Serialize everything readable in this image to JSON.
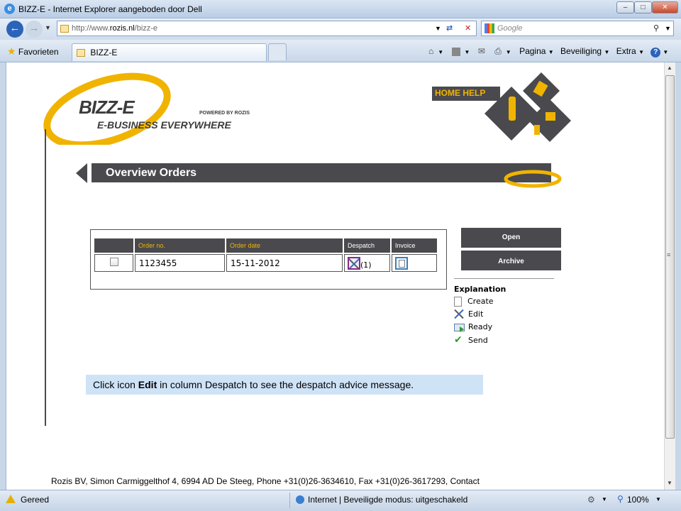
{
  "window": {
    "title": "BIZZ-E - Internet Explorer aangeboden door Dell"
  },
  "toolbar": {
    "url_prefix": "http://www.",
    "url_domain": "rozis.nl",
    "url_path": "/bizz-e",
    "search_placeholder": "Google"
  },
  "tabs": {
    "favorites": "Favorieten",
    "active_tab": "BIZZ-E",
    "menu_page": "Pagina",
    "menu_security": "Beveiliging",
    "menu_extra": "Extra"
  },
  "logo": {
    "brand": "BIZZ-E",
    "tagline": "E-BUSINESS EVERYWHERE",
    "powered": "POWERED BY ROZIS"
  },
  "header": {
    "home_help": "HOME HELP"
  },
  "page": {
    "title": "Overview Orders"
  },
  "orders_table": {
    "headers": [
      "",
      "Order no.",
      "Order date",
      "Despatch",
      "Invoice"
    ],
    "rows": [
      {
        "order_no": "1123455",
        "order_date": "15-11-2012",
        "despatch_count": "(1)"
      }
    ]
  },
  "actions": {
    "open": "Open",
    "archive": "Archive"
  },
  "legend": {
    "title": "Explanation",
    "items": [
      {
        "label": "Create",
        "icon": "document-icon"
      },
      {
        "label": "Edit",
        "icon": "edit-tools-icon"
      },
      {
        "label": "Ready",
        "icon": "envelope-arrow-icon"
      },
      {
        "label": "Send",
        "icon": "checkmark-icon"
      }
    ]
  },
  "hint": {
    "prefix": "Click icon ",
    "bold": "Edit",
    "suffix": " in column Despatch to see the despatch advice message."
  },
  "footer": {
    "address": "Rozis BV, Simon Carmiggelthof 4, 6994 AD De Steeg, Phone +31(0)26-3634610, Fax +31(0)26-3617293, Contact"
  },
  "status": {
    "left": "Gereed",
    "zone": "Internet | Beveiligde modus: uitgeschakeld",
    "zoom": "100%"
  },
  "colors": {
    "accent_yellow": "#f0b400",
    "dark_band": "#4a4a4e",
    "hint_bg": "#cfe3f7"
  }
}
